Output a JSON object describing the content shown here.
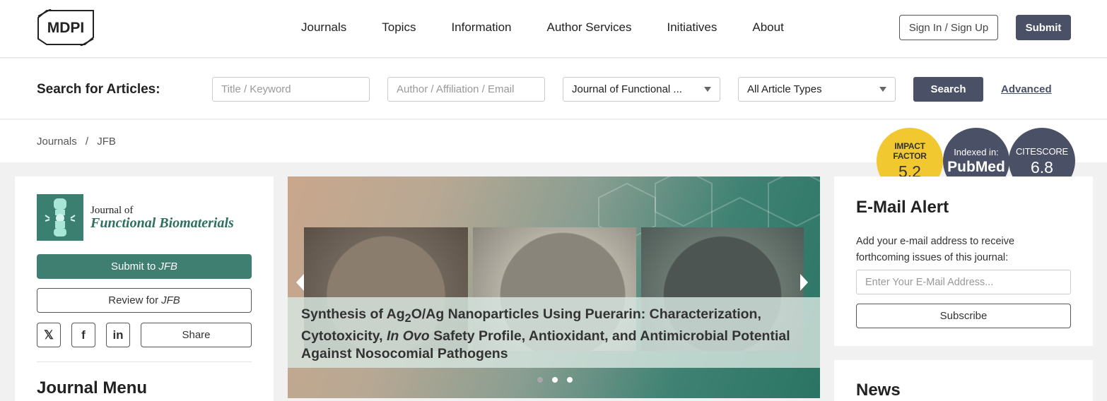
{
  "header": {
    "logo_text": "MDPI",
    "nav": [
      "Journals",
      "Topics",
      "Information",
      "Author Services",
      "Initiatives",
      "About"
    ],
    "sign_in_label": "Sign In / Sign Up",
    "submit_label": "Submit"
  },
  "search": {
    "label": "Search for Articles:",
    "title_placeholder": "Title / Keyword",
    "author_placeholder": "Author / Affiliation / Email",
    "journal_selected": "Journal of Functional ...",
    "type_selected": "All Article Types",
    "search_label": "Search",
    "advanced_label": "Advanced"
  },
  "breadcrumb": {
    "items": [
      "Journals",
      "/",
      "JFB"
    ]
  },
  "badges": {
    "impact": {
      "line1": "IMPACT",
      "line2": "FACTOR",
      "value": "5.2",
      "color": "#f2c830"
    },
    "indexed": {
      "line1": "Indexed in:",
      "value": "PubMed",
      "color": "#4a5065"
    },
    "citescore": {
      "line1": "CITESCORE",
      "value": "6.8",
      "color": "#4a5065"
    }
  },
  "sidebar": {
    "journal_of": "Journal of",
    "journal_name": "Functional Biomaterials",
    "submit_to": "Submit to",
    "review_for": "Review for",
    "journal_abbr": "JFB",
    "social": {
      "x": "𝕏",
      "facebook": "f",
      "linkedin": "in"
    },
    "share_label": "Share",
    "menu_title": "Journal Menu",
    "accent_color": "#3f7f72"
  },
  "carousel": {
    "title_part1": "Synthesis of Ag",
    "sub": "2",
    "title_part2": "O/Ag Nanoparticles Using Puerarin: Characterization, Cytotoxicity, ",
    "title_italic": "In Ovo",
    "title_part3": " Safety Profile, Antioxidant, and Antimicrobial Potential Against Nosocomial Pathogens",
    "slide_count": 3,
    "active_slide": 1
  },
  "email_alert": {
    "title": "E-Mail Alert",
    "text": "Add your e-mail address to receive forthcoming issues of this journal:",
    "placeholder": "Enter Your E-Mail Address...",
    "subscribe_label": "Subscribe"
  },
  "news": {
    "title": "News"
  }
}
